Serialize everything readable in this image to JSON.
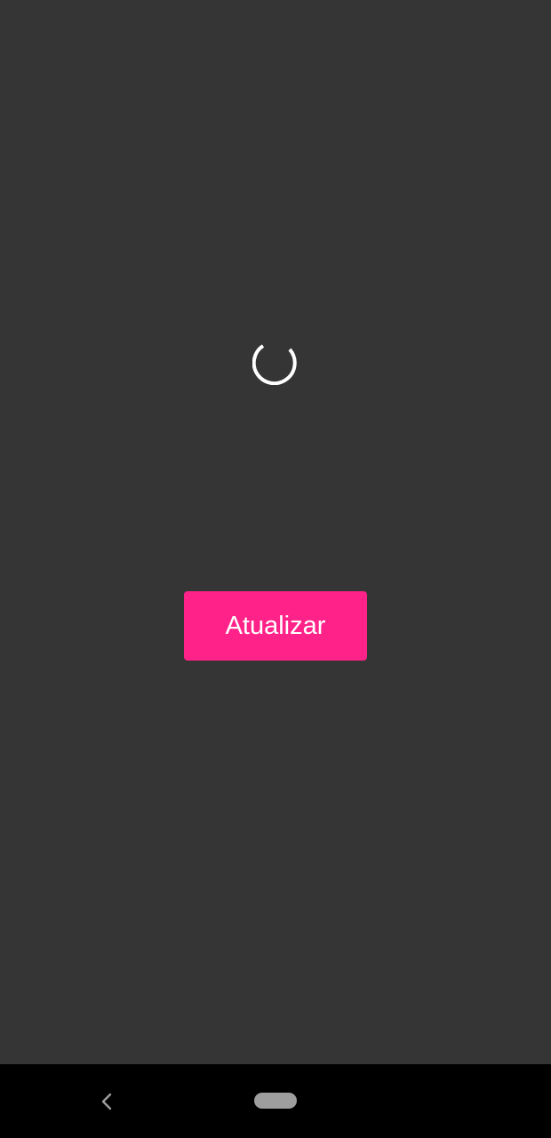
{
  "colors": {
    "background": "#353535",
    "spinner": "#ffffff",
    "accent": "#ff2289",
    "nav_bar": "#000000",
    "nav_icon": "#9e9e9e"
  },
  "spinner": {
    "icon": "loading-spinner-icon"
  },
  "main": {
    "refresh_label": "Atualizar"
  },
  "nav": {
    "back_icon": "chevron-left-icon",
    "home_icon": "home-pill-icon"
  }
}
